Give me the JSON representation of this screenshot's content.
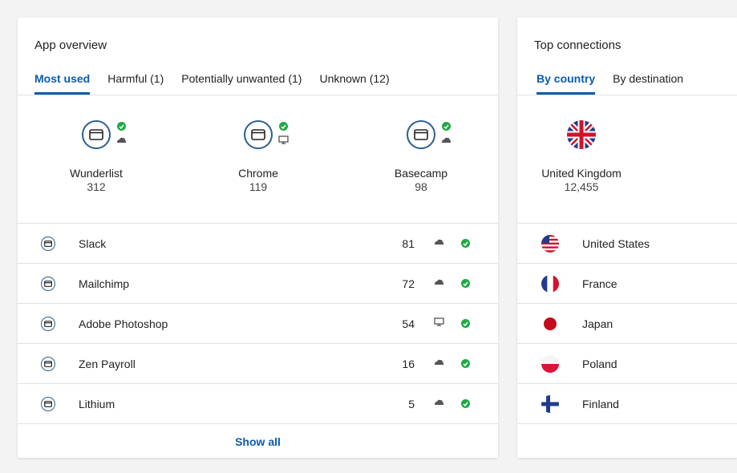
{
  "app_overview": {
    "title": "App overview",
    "tabs": [
      {
        "label": "Most used",
        "active": true
      },
      {
        "label": "Harmful (1)",
        "active": false
      },
      {
        "label": "Potentially unwanted (1)",
        "active": false
      },
      {
        "label": "Unknown (12)",
        "active": false
      }
    ],
    "top_apps": [
      {
        "name": "Wunderlist",
        "count": "312",
        "type_icon": "cloud-icon",
        "status_icon": "check-icon"
      },
      {
        "name": "Chrome",
        "count": "119",
        "type_icon": "desktop-icon",
        "status_icon": "check-icon"
      },
      {
        "name": "Basecamp",
        "count": "98",
        "type_icon": "cloud-icon",
        "status_icon": "check-icon"
      }
    ],
    "apps": [
      {
        "name": "Slack",
        "count": "81",
        "type_icon": "cloud-icon",
        "status_icon": "check-icon"
      },
      {
        "name": "Mailchimp",
        "count": "72",
        "type_icon": "cloud-icon",
        "status_icon": "check-icon"
      },
      {
        "name": "Adobe Photoshop",
        "count": "54",
        "type_icon": "desktop-icon",
        "status_icon": "check-icon"
      },
      {
        "name": "Zen Payroll",
        "count": "16",
        "type_icon": "cloud-icon",
        "status_icon": "check-icon"
      },
      {
        "name": "Lithium",
        "count": "5",
        "type_icon": "cloud-icon",
        "status_icon": "check-icon"
      }
    ],
    "show_all_label": "Show all"
  },
  "top_connections": {
    "title": "Top connections",
    "tabs": [
      {
        "label": "By country",
        "active": true
      },
      {
        "label": "By destination",
        "active": false
      }
    ],
    "top_country": {
      "name": "United Kingdom",
      "count": "12,455",
      "flag_icon": "uk-flag-icon"
    },
    "countries": [
      {
        "name": "United States",
        "flag_icon": "us-flag-icon"
      },
      {
        "name": "France",
        "flag_icon": "france-flag-icon"
      },
      {
        "name": "Japan",
        "flag_icon": "japan-flag-icon"
      },
      {
        "name": "Poland",
        "flag_icon": "poland-flag-icon"
      },
      {
        "name": "Finland",
        "flag_icon": "finland-flag-icon"
      }
    ]
  },
  "colors": {
    "accent": "#0b5cad",
    "icon_outline": "#2d5f8f",
    "status_ok": "#21a845",
    "background": "#f3f3f3"
  }
}
